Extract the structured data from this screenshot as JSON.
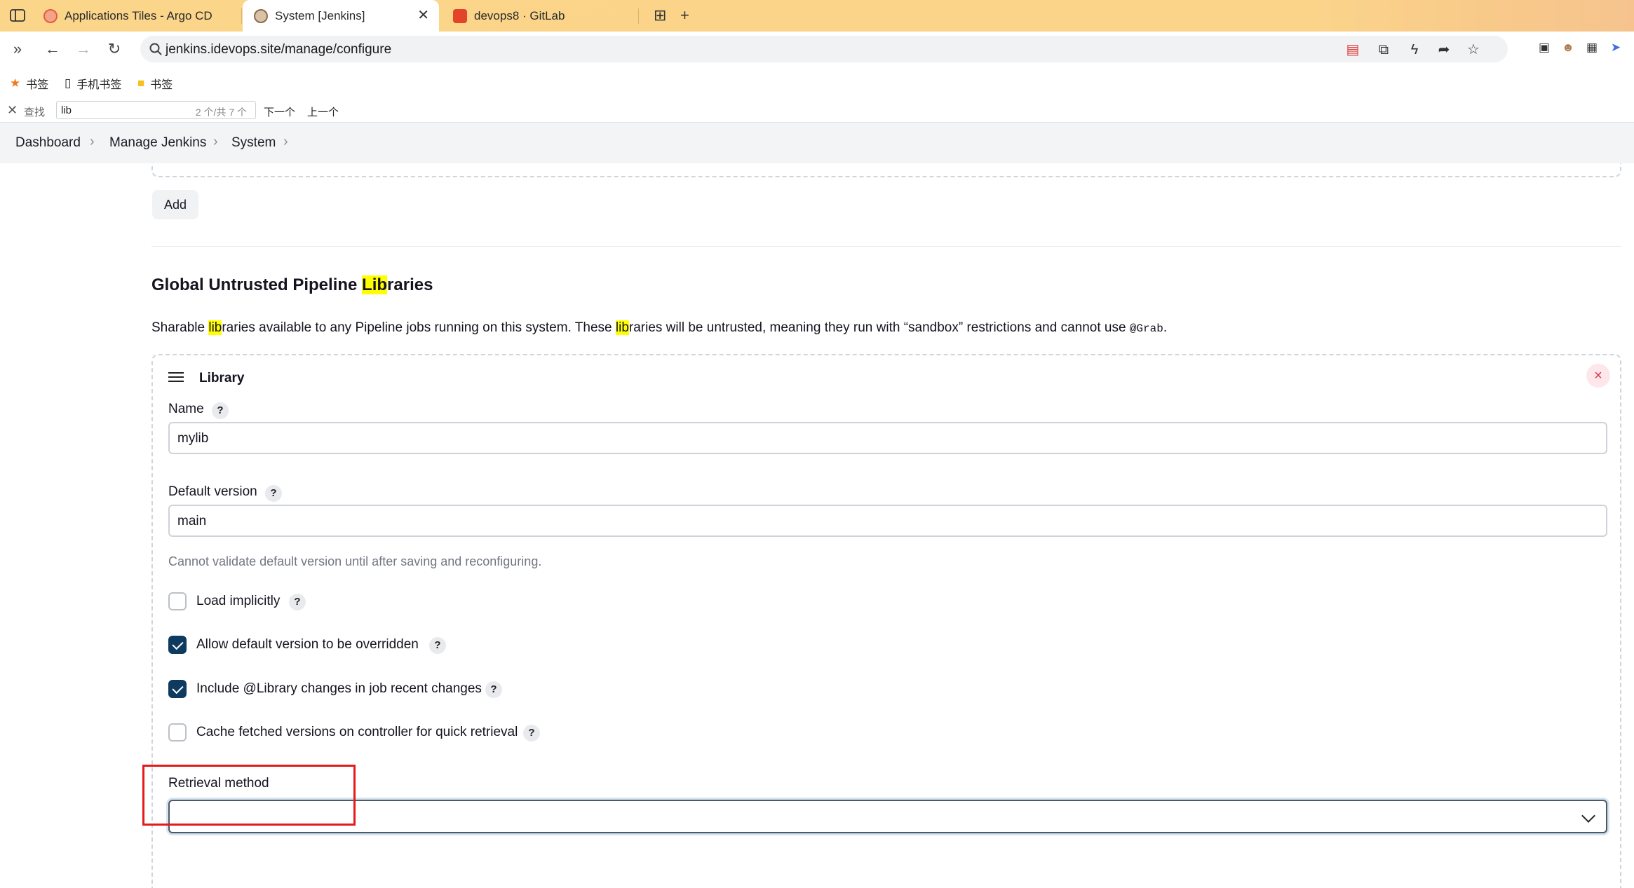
{
  "browser": {
    "tabs": [
      {
        "title": "Applications Tiles - Argo CD",
        "active": false
      },
      {
        "title": "System [Jenkins]",
        "active": true
      },
      {
        "title": "devops8 · GitLab",
        "active": false
      }
    ],
    "url": "jenkins.idevops.site/manage/configure",
    "bookmarks": [
      {
        "label": "书签",
        "icon": "star-icon"
      },
      {
        "label": "手机书签",
        "icon": "phone-icon"
      },
      {
        "label": "书签",
        "icon": "folder-icon"
      }
    ],
    "find": {
      "label": "查找",
      "value": "lib",
      "count": "2 个/共 7 个",
      "next": "下一个",
      "prev": "上一个"
    }
  },
  "breadcrumbs": [
    "Dashboard",
    "Manage Jenkins",
    "System"
  ],
  "page": {
    "add_label": "Add",
    "section_title_pre": "Global Untrusted Pipeline ",
    "section_title_hl": "Lib",
    "section_title_post": "raries",
    "desc": {
      "p1": "Sharable ",
      "h1": "lib",
      "p2": "raries available to any Pipeline jobs running on this system. These ",
      "h2": "lib",
      "p3": "raries will be untrusted, meaning they run with “sandbox” restrictions and cannot use ",
      "code": "@Grab",
      "p4": "."
    },
    "library": {
      "title": "Library",
      "name_label": "Name",
      "name_value": "mylib",
      "default_version_label": "Default version",
      "default_version_value": "main",
      "default_version_hint": "Cannot validate default version until after saving and reconfiguring.",
      "checkboxes": [
        {
          "label": "Load implicitly",
          "checked": false
        },
        {
          "label": "Allow default version to be overridden",
          "checked": true
        },
        {
          "label": "Include @Library changes in job recent changes",
          "checked": true
        },
        {
          "label": "Cache fetched versions on controller for quick retrieval",
          "checked": false
        }
      ],
      "retrieval_label": "Retrieval method",
      "retrieval_value": ""
    },
    "help_glyph": "?",
    "remove_glyph": "×"
  },
  "colors": {
    "accent": "#0f3a5f",
    "highlight": "#ffff00",
    "annotation_box": "#e31b1b"
  }
}
